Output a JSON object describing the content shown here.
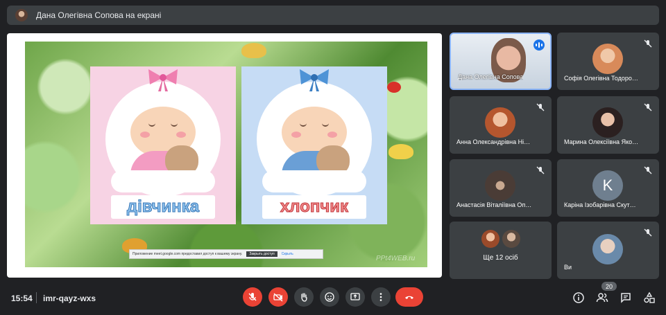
{
  "presenter": {
    "text": "Дана Олегівна Сопова на екрані"
  },
  "slide": {
    "girl_word": "дівчинка",
    "boy_word": "хлопчик",
    "notification": {
      "text": "Приложение meet.google.com предоставил доступ к вашему экрану.",
      "stop_button": "Закрыть доступ",
      "hide_link": "Скрыть"
    },
    "watermark": "PPt4WEB.ru"
  },
  "participants": [
    {
      "name": "Дана Олегівна Сопова"
    },
    {
      "name": "Софія Олегівна Тодоро…"
    },
    {
      "name": "Анна Олександрівна Ні…"
    },
    {
      "name": "Марина Олексіївна Яко…"
    },
    {
      "name": "Анастасія Віталіївна Оп…"
    },
    {
      "name": "Каріна Ізобарівна Скут…",
      "initial": "K"
    },
    {
      "more": "Ще 12 осіб"
    },
    {
      "name": "Ви"
    }
  ],
  "bottom_bar": {
    "time": "15:54",
    "meeting_code": "imr-qayz-wxs",
    "participant_count": "20"
  },
  "icons": [
    "mic-off-icon",
    "camera-off-icon",
    "raise-hand-icon",
    "emoji-icon",
    "present-icon",
    "more-icon",
    "end-call-icon",
    "info-icon",
    "people-icon",
    "chat-icon",
    "activities-icon"
  ],
  "colors": {
    "background": "#202124",
    "tile": "#3c4043",
    "red": "#ea4335",
    "accent": "#1a73e8"
  }
}
